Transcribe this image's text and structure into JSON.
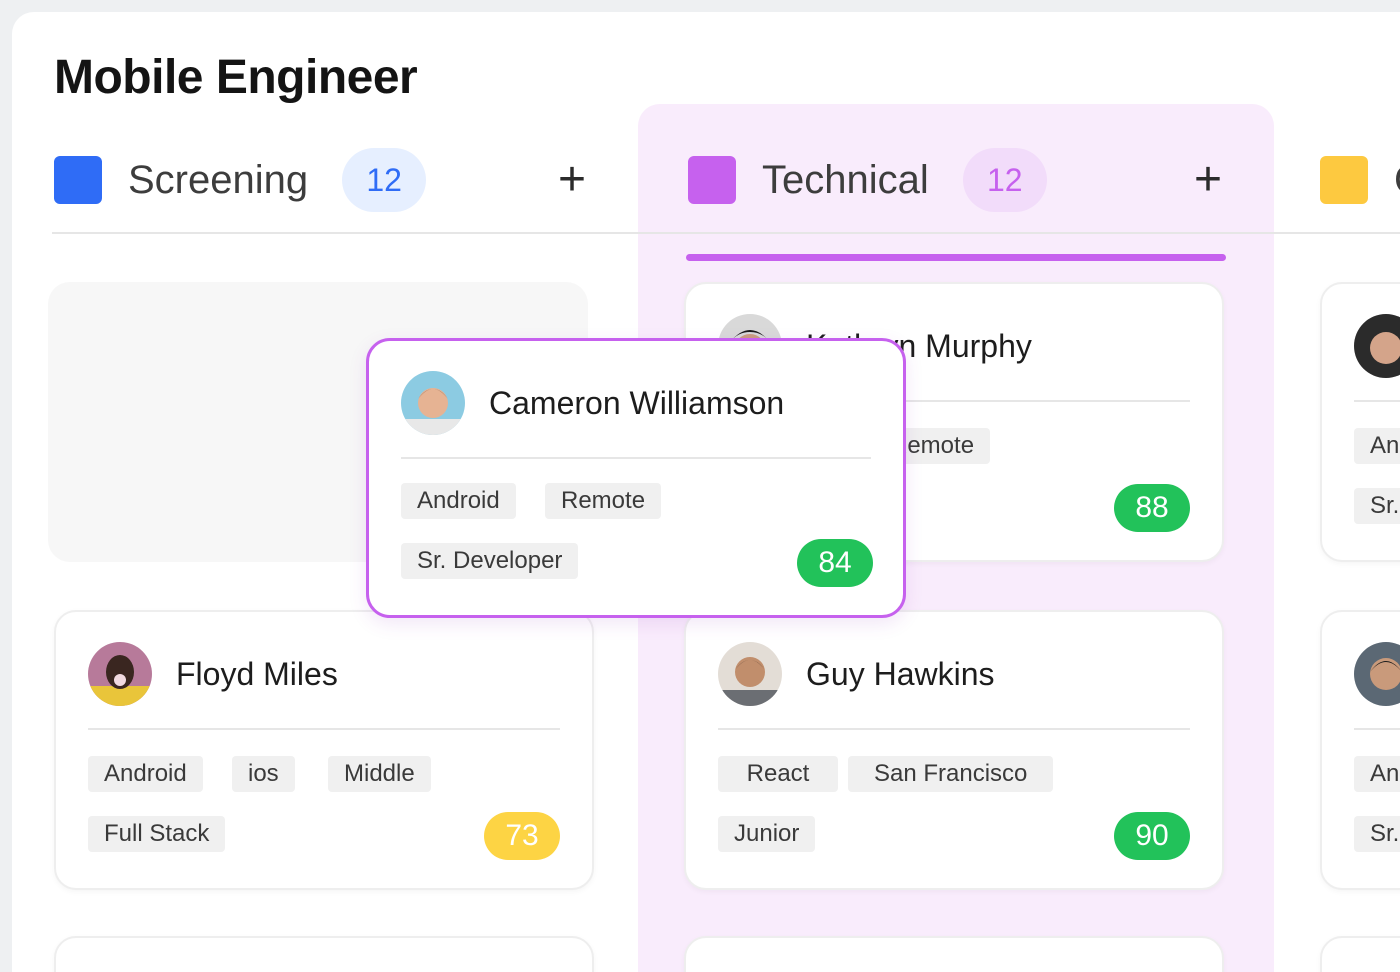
{
  "page": {
    "title": "Mobile Engineer"
  },
  "colors": {
    "screening": "#2f6cf6",
    "technical": "#c661ee",
    "third": "#fdc940",
    "score_green": "#22c25a",
    "score_yellow": "#fdd444"
  },
  "columns": [
    {
      "name": "Screening",
      "count": "12",
      "add_icon": "plus-icon"
    },
    {
      "name": "Technical",
      "count": "12",
      "add_icon": "plus-icon"
    },
    {
      "name": "C",
      "count": ""
    }
  ],
  "cards": {
    "dragged": {
      "name": "Cameron Williamson",
      "tags": [
        "Android",
        "Remote",
        "Sr. Developer"
      ],
      "score": "84"
    },
    "floyd": {
      "name": "Floyd Miles",
      "tags": [
        "Android",
        "ios",
        "Middle",
        "Full Stack"
      ],
      "score": "73"
    },
    "kathryn": {
      "name": "Kathryn Murphy",
      "tags": [
        "Remote"
      ],
      "score": "88"
    },
    "guy": {
      "name": "Guy Hawkins",
      "tags": [
        "React",
        "San Francisco",
        "Junior"
      ],
      "score": "90"
    },
    "right1": {
      "tags": [
        "An",
        "Sr."
      ]
    },
    "right2": {
      "tags": [
        "An",
        "Sr."
      ]
    }
  }
}
